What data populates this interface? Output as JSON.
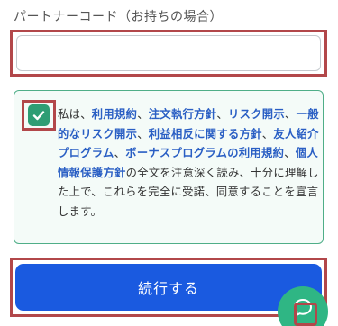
{
  "partner_code": {
    "label": "パートナーコード（お持ちの場合）",
    "value": "",
    "placeholder": ""
  },
  "agreement": {
    "checked": true,
    "text_prefix": "私は、",
    "link_terms": "利用規約",
    "sep1": "、",
    "link_order_policy": "注文執行方針",
    "sep2": "、",
    "link_risk": "リスク開示",
    "sep3": "、",
    "link_general_risk": "一般的なリスク開示",
    "sep4": "、",
    "link_conflict": "利益相反に関する方針",
    "sep5": "、",
    "link_referral": "友人紹介プログラム",
    "sep6": "、",
    "link_bonus": "ボーナスプログラムの利用規約",
    "sep7": "、",
    "link_privacy": "個人情報保護方針",
    "text_suffix": "の全文を注意深く読み、十分に理解した上で、これらを完全に受諾、同意することを宣言します。"
  },
  "submit_button": {
    "label": "続行する"
  },
  "colors": {
    "accent_green": "#2e9d74",
    "button_blue": "#1a5ae0",
    "link_blue": "#2a5fc4",
    "highlight_red": "#b2474a"
  },
  "icons": {
    "checkbox": "checkmark-icon",
    "fab": "chat-support-icon"
  }
}
